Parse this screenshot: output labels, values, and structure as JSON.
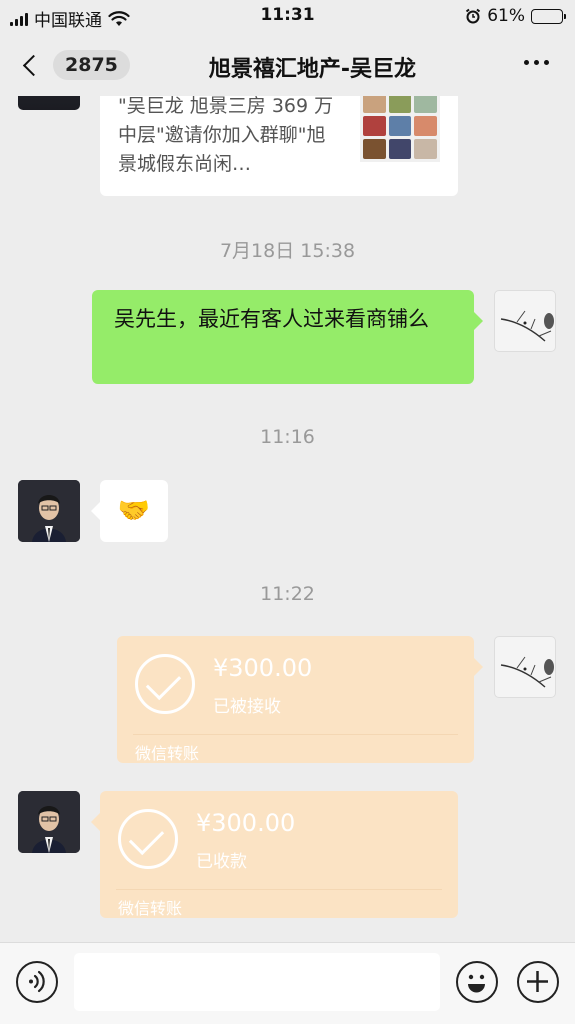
{
  "status_bar": {
    "carrier": "中国联通",
    "time": "11:31",
    "battery_percent": "61%",
    "battery_level": 0.61
  },
  "header": {
    "unread_count": "2875",
    "title": "旭景禧汇地产-吴巨龙"
  },
  "messages": {
    "invite_card": {
      "text": "\"吴巨龙 旭景三房 369 万中层\"邀请你加入群聊\"旭景城假东尚闲…"
    },
    "time_1": "7月18日 15:38",
    "outgoing_text": "吴先生，最近有客人过来看商铺么",
    "time_2": "11:16",
    "incoming_emoji": "🤝",
    "time_3": "11:22",
    "transfer_sent": {
      "amount": "¥300.00",
      "status": "已被接收",
      "label": "微信转账"
    },
    "transfer_received": {
      "amount": "¥300.00",
      "status": "已收款",
      "label": "微信转账"
    }
  },
  "input": {
    "placeholder": ""
  },
  "colors": {
    "background": "#ededed",
    "outgoing_bubble": "#95ec69",
    "incoming_bubble": "#ffffff",
    "transfer_card": "#fbe3c4"
  }
}
